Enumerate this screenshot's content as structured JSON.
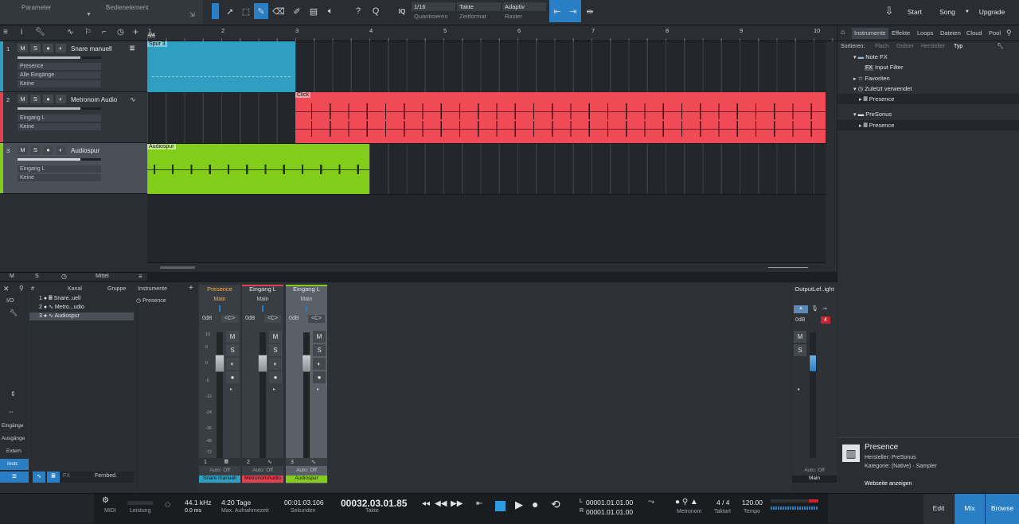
{
  "topbar": {
    "parameter": "Parameter",
    "bedienelement": "Bedienelement",
    "quantize_label": "IQ",
    "quantize_value": "1/16",
    "quantize_sub": "Quantisieren",
    "timeformat_value": "Takte",
    "timeformat_sub": "Zeitformat",
    "grid_value": "Adaptiv",
    "grid_sub": "Raster",
    "start": "Start",
    "song": "Song",
    "upgrade": "Upgrade",
    "help_icon": "?",
    "search_icon": "Q"
  },
  "tracks": [
    {
      "num": "1",
      "name": "Snare manuell",
      "slot1": "Presence",
      "slot2": "Alle Eingänge",
      "slot3": "Keine",
      "color": "#2e9fc0"
    },
    {
      "num": "2",
      "name": "Metronom Audio",
      "slot1": "Eingang L",
      "slot2": "Keine",
      "color": "#e0424f"
    },
    {
      "num": "3",
      "name": "Audiospur",
      "slot1": "Eingang L",
      "slot2": "Keine",
      "color": "#86cc1e"
    }
  ],
  "track_buttons": {
    "m": "M",
    "s": "S"
  },
  "ruler": [
    "1",
    "2",
    "3",
    "4",
    "5",
    "6",
    "7",
    "8",
    "9",
    "10"
  ],
  "ruler_sig": "4/4",
  "clips": [
    {
      "label": "Spur 3",
      "color": "#2e9fc0"
    },
    {
      "label": "Click",
      "color": "#ef4a55"
    },
    {
      "label": "Audiospur",
      "color": "#82cc1a"
    }
  ],
  "arrange_footer": {
    "m": "M",
    "s": "S",
    "mittel": "Mittel"
  },
  "browser": {
    "tabs": [
      "Instrumente",
      "Effekte",
      "Loops",
      "Dateien",
      "Cloud",
      "Pool"
    ],
    "sort_label": "Sortieren:",
    "sort_opts": [
      "Flach",
      "Ordner",
      "Hersteller",
      "Typ"
    ],
    "items": [
      {
        "label": "Note FX",
        "indent": 1
      },
      {
        "label": "Input Filter",
        "indent": 3
      },
      {
        "label": "Favoriten",
        "indent": 1
      },
      {
        "label": "Zuletzt verwendet",
        "indent": 1
      },
      {
        "label": "Presence",
        "indent": 2
      },
      {
        "label": "PreSonus",
        "indent": 1
      },
      {
        "label": "Presence",
        "indent": 2
      }
    ],
    "info_title": "Presence",
    "info_maker": "Hersteller: PreSonus",
    "info_cat": "Kategorie: (Native) · Sampler",
    "info_link": "Webseite anzeigen"
  },
  "mixer": {
    "io": "I/O",
    "kanal": "Kanal",
    "gruppe": "Gruppe",
    "channels": [
      {
        "num": "1",
        "name": "Snare..uell"
      },
      {
        "num": "2",
        "name": "Metro...udio"
      },
      {
        "num": "3",
        "name": "Audiospur"
      }
    ],
    "left_labels": [
      "Eingänge",
      "Ausgänge",
      "Extern",
      "Instr."
    ],
    "instrumente": "Instrumente",
    "inst_item": "Presence",
    "fernbed": "Fernbed.",
    "fx": "FX",
    "strips": [
      {
        "name": "Presence",
        "out": "Main",
        "db": "0dB",
        "pan": "<C>",
        "num": "1",
        "auto": "Auto: Off",
        "bottom": "Snare manuell",
        "color": "#2e9fc0"
      },
      {
        "name": "Eingang L",
        "out": "Main",
        "db": "0dB",
        "pan": "<C>",
        "num": "2",
        "auto": "Auto: Off",
        "bottom": "MetronomAudio",
        "color": "#e0424f"
      },
      {
        "name": "Eingang L",
        "out": "Main",
        "db": "0dB",
        "pan": "<C>",
        "num": "3",
        "auto": "Auto: Off",
        "bottom": "Audiospur",
        "color": "#86cc1e"
      }
    ],
    "master": {
      "name": "OutputLef..ight",
      "db": "0dB",
      "clip": "4",
      "auto": "Auto: Off",
      "bottom": "Main"
    },
    "scale": [
      "10",
      "6",
      "0",
      "-6",
      "-12",
      "-24",
      "-36",
      "-48",
      "-72"
    ]
  },
  "transport": {
    "midi": "MIDI",
    "leistung": "Leistung",
    "rate": "44.1 kHz",
    "latency": "0.0 ms",
    "rec_time": "4:20 Tage",
    "rec_label": "Max. Aufnahmezeit",
    "seconds": "00:01:03.106",
    "seconds_label": "Sekunden",
    "position": "00032.03.01.85",
    "position_label": "Takte",
    "loop_l": "00001.01.01.00",
    "loop_r": "00001.01.01.00",
    "metronom": "Metronom",
    "sig": "4 / 4",
    "sig_label": "Taktart",
    "tempo": "120.00",
    "tempo_label": "Tempo",
    "edit": "Edit",
    "mix": "Mix",
    "browse": "Browse"
  }
}
